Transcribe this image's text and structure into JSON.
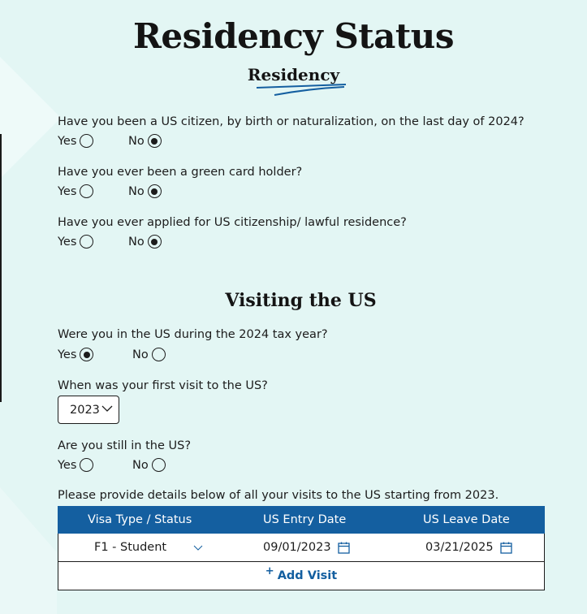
{
  "page": {
    "title": "Residency Status",
    "section_tab": "Residency",
    "accent_color": "#145fa0",
    "background_color": "#e3f6f4"
  },
  "residency": {
    "questions": [
      {
        "label": "Have you been a US citizen, by birth or naturalization, on the last day of 2024?",
        "options": [
          {
            "label": "Yes",
            "checked": false
          },
          {
            "label": "No",
            "checked": true
          }
        ]
      },
      {
        "label": "Have you ever been a green card holder?",
        "options": [
          {
            "label": "Yes",
            "checked": false
          },
          {
            "label": "No",
            "checked": true
          }
        ]
      },
      {
        "label": "Have you ever applied for US citizenship/ lawful residence?",
        "options": [
          {
            "label": "Yes",
            "checked": false
          },
          {
            "label": "No",
            "checked": true
          }
        ]
      }
    ]
  },
  "visiting": {
    "heading": "Visiting the US",
    "in_us_question": {
      "label": "Were you in the US during the 2024 tax year?",
      "options": [
        {
          "label": "Yes",
          "checked": true
        },
        {
          "label": "No",
          "checked": false
        }
      ]
    },
    "first_visit": {
      "label": "When was your first visit to the US?",
      "value": "2023"
    },
    "still_in_us": {
      "label": "Are you still in the US?",
      "options": [
        {
          "label": "Yes",
          "checked": false
        },
        {
          "label": "No",
          "checked": false
        }
      ]
    },
    "details_prompt": "Please provide details below of all your visits to the US starting from 2023."
  },
  "visits_table": {
    "columns": [
      "Visa Type / Status",
      "US Entry Date",
      "US Leave Date"
    ],
    "rows": [
      {
        "visa_type": "F1 - Student",
        "entry_date": "09/01/2023",
        "leave_date": "03/21/2025"
      }
    ],
    "add_label": "Add Visit",
    "add_icon": "plus-icon"
  }
}
